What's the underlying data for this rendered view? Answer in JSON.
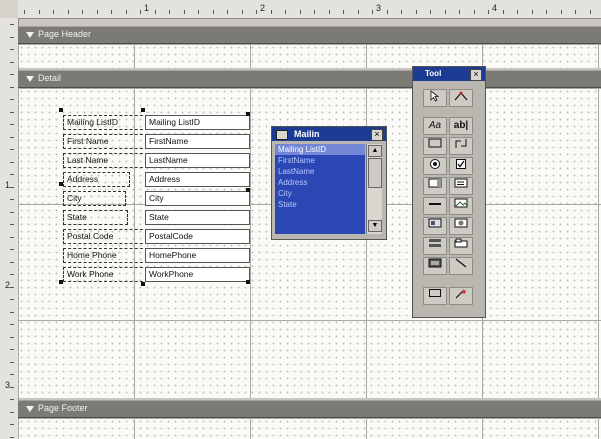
{
  "rulers": {
    "top_numbers": [
      "1",
      "2",
      "3",
      "4"
    ],
    "left_numbers": [
      "1",
      "2",
      "3"
    ]
  },
  "sections": {
    "page_header": "Page Header",
    "detail": "Detail",
    "page_footer": "Page Footer"
  },
  "fields": [
    {
      "label": "Mailing ListID",
      "control": "Mailing ListID"
    },
    {
      "label": "First Name",
      "control": "FirstName"
    },
    {
      "label": "Last Name",
      "control": "LastName"
    },
    {
      "label": "Address",
      "control": "Address"
    },
    {
      "label": "City",
      "control": "City"
    },
    {
      "label": "State",
      "control": "State"
    },
    {
      "label": "Postal Code",
      "control": "PostalCode"
    },
    {
      "label": "Home Phone",
      "control": "HomePhone"
    },
    {
      "label": "Work Phone",
      "control": "WorkPhone"
    }
  ],
  "field_list": {
    "title": "Mailin",
    "close": "×",
    "items": [
      "Mailing ListID",
      "FirstName",
      "LastName",
      "Address",
      "City",
      "State"
    ]
  },
  "toolbox": {
    "title": "Tool",
    "close": "×",
    "label_tool": "Aa",
    "textbox_tool": "ab|",
    "tools": [
      "select-pointer-icon",
      "control-wizard-icon",
      "label-tool",
      "text-box-tool",
      "option-group-icon",
      "toggle-button-icon",
      "option-button-icon",
      "check-box-icon",
      "combo-box-icon",
      "list-box-icon",
      "command-button-icon",
      "image-icon",
      "unbound-object-frame-icon",
      "bound-object-frame-icon",
      "page-break-icon",
      "tab-control-icon",
      "subform-icon",
      "line-icon",
      "rectangle-icon",
      "more-controls-icon"
    ]
  },
  "colors": {
    "title_bar": "#1c3b92",
    "band": "#7c7a74",
    "field_list_body": "#2a47b3"
  }
}
